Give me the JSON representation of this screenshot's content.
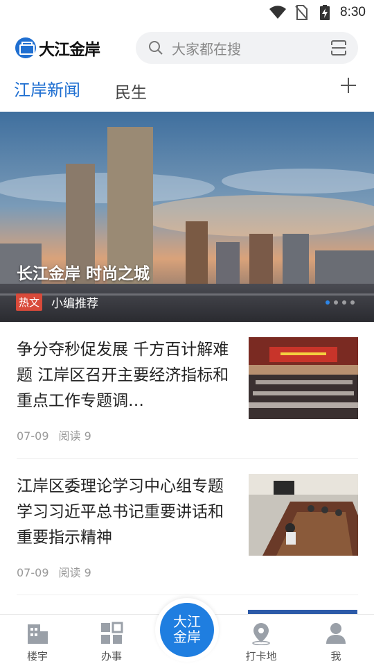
{
  "status_bar": {
    "time": "8:30",
    "icons": [
      "wifi-icon",
      "no-sim-icon",
      "battery-charging-icon"
    ]
  },
  "header": {
    "logo_text": "大江金岸",
    "search_placeholder": "大家都在搜",
    "icons": [
      "search-icon",
      "scan-icon"
    ]
  },
  "tabs": [
    {
      "label": "江岸新闻",
      "active": true
    },
    {
      "label": "民生",
      "active": false
    }
  ],
  "banner": {
    "title": "长江金岸 时尚之城",
    "tag": "热文",
    "subtitle": "小编推荐",
    "slide_count": 4,
    "active_slide": 1
  },
  "articles": [
    {
      "title": "争分夺秒促发展 千方百计解难题 江岸区召开主要经济指标和重点工作专题调…",
      "date": "07-09",
      "reads": "阅读 9"
    },
    {
      "title": "江岸区委理论学习中心组专题学习习近平总书记重要讲话和重要指示精神",
      "date": "07-09",
      "reads": "阅读 9"
    }
  ],
  "bottom_nav": {
    "items": [
      {
        "label": "楼宇",
        "icon": "building-icon"
      },
      {
        "label": "办事",
        "icon": "grid-icon"
      },
      {
        "label": "打卡地",
        "icon": "location-pin-icon"
      },
      {
        "label": "我",
        "icon": "person-icon"
      }
    ],
    "center_label_line1": "大江",
    "center_label_line2": "金岸"
  },
  "colors": {
    "accent": "#1f6fd1",
    "tag_red": "#d84a3a"
  }
}
